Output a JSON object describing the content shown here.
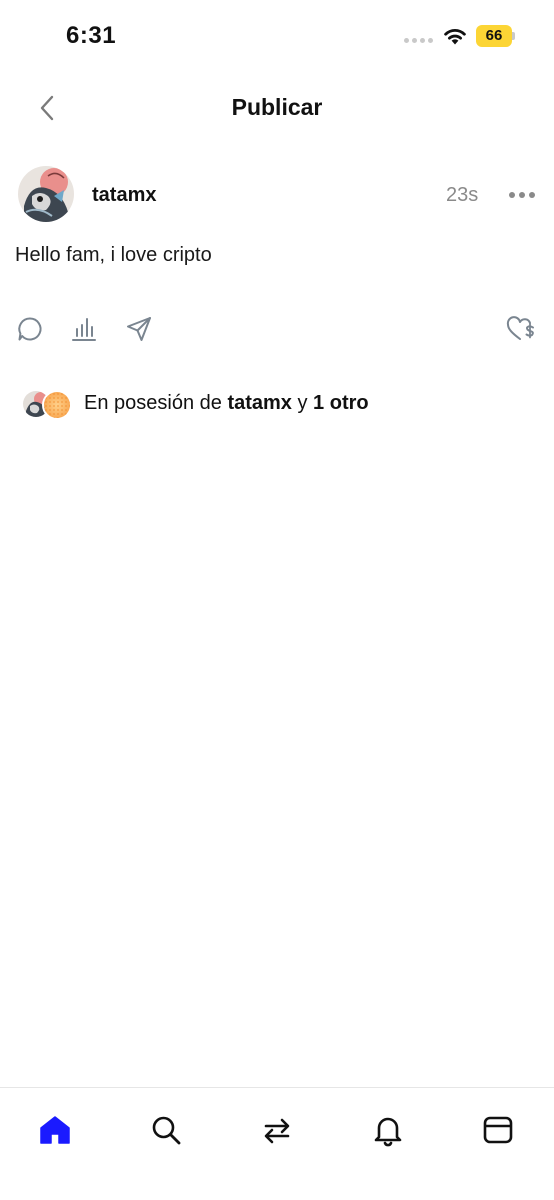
{
  "status_bar": {
    "time": "6:31",
    "battery_level": "66",
    "battery_color": "#fcd535"
  },
  "header": {
    "title": "Publicar",
    "back_icon": "chevron-left-icon"
  },
  "post": {
    "username": "tatamx",
    "time_ago": "23s",
    "text": "Hello fam, i love cripto",
    "actions": [
      {
        "icon": "comment-icon"
      },
      {
        "icon": "stats-icon"
      },
      {
        "icon": "send-icon"
      },
      {
        "icon": "heart-dollar-icon"
      }
    ]
  },
  "holders": {
    "prefix": "En posesión de ",
    "first_holder": "tatamx",
    "connector": " y ",
    "others": "1 otro"
  },
  "bottom_nav": {
    "active_color": "#1a1aff",
    "items": [
      {
        "icon": "home-icon",
        "active": true
      },
      {
        "icon": "search-icon",
        "active": false
      },
      {
        "icon": "swap-icon",
        "active": false
      },
      {
        "icon": "bell-icon",
        "active": false
      },
      {
        "icon": "wallet-icon",
        "active": false
      }
    ]
  }
}
